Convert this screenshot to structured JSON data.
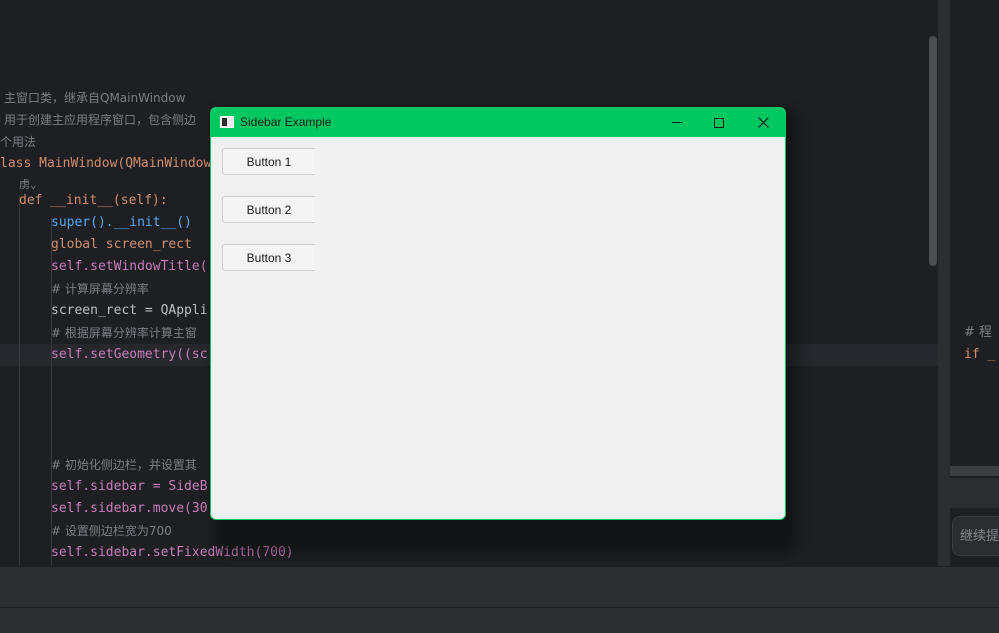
{
  "editor": {
    "lines": [
      "主窗口类，继承自QMainWindow",
      "用于创建主应用程序窗口，包含侧边",
      "个用法",
      "lass MainWindow(QMainWindow",
      "def __init__(self):",
      "super().__init__()",
      "global screen_rect",
      "self.setWindowTitle(",
      "# 计算屏幕分辨率",
      "screen_rect = QAppli",
      "# 根据屏幕分辨率计算主窗",
      "self.setGeometry((sc",
      "# 初始化侧边栏，并设置其",
      "self.sidebar = SideB",
      "self.sidebar.move(30",
      "# 设置侧边栏宽为700",
      "self.sidebar.setFixedWidth(700)"
    ],
    "inline_marker": "虏⌄"
  },
  "right_panel": {
    "comment": "# 程",
    "if_fragment": "if _",
    "input_placeholder": "继续提"
  },
  "window": {
    "title": "Sidebar Example",
    "buttons": [
      "Button 1",
      "Button 2",
      "Button 3"
    ],
    "accent": "#00c860"
  }
}
